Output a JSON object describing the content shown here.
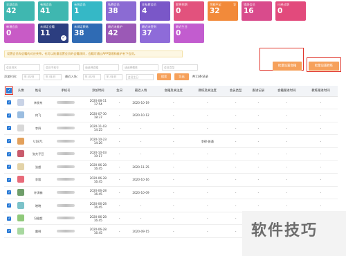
{
  "cards_row1": [
    {
      "label": "全部会员",
      "value": "42",
      "color": "#3fb7b0"
    },
    {
      "label": "有效会员",
      "value": "41",
      "color": "#3fb7b0"
    },
    {
      "label": "无效会员",
      "value": "1",
      "color": "#35b8c6"
    },
    {
      "label": "私教会员",
      "value": "38",
      "color": "#8b6bd3"
    },
    {
      "label": "非私教会员",
      "value": "4",
      "color": "#7a57c8"
    },
    {
      "label": "即将到期",
      "value": "0",
      "color": "#e2527d"
    },
    {
      "label": "余额不足",
      "value": "32",
      "color": "#f28a3a",
      "tag": "导"
    },
    {
      "label": "锁屏会员",
      "value": "16",
      "color": "#d94b8c"
    },
    {
      "label": "已经过期",
      "value": "0",
      "color": "#e24a7c"
    }
  ],
  "cards_row2": [
    {
      "label": "新增会员",
      "value": "0",
      "color": "#c85bc6"
    },
    {
      "label": "未绑定会籍",
      "value": "11",
      "color": "#2c3e80",
      "checked": true
    },
    {
      "label": "未绑定教练",
      "value": "38",
      "color": "#2f6bb4"
    },
    {
      "label": "最近未维护",
      "value": "42",
      "color": "#9b59b6"
    },
    {
      "label": "最近未签到",
      "value": "37",
      "color": "#8e6bd9"
    },
    {
      "label": "最近生日",
      "value": "0",
      "color": "#c25ccf"
    }
  ],
  "notice": "设置会员和会籍的对应关系，也可以批量设置会员的会籍顾问，会籍可通过APP管理和维护名下会员。",
  "actions": {
    "assign_consultant": "批量设置会籍",
    "assign_coach": "批量设置教练"
  },
  "filters": {
    "row1": [
      "会员姓名",
      "会员手机号",
      "请选择会籍",
      "请选择教练",
      "会员类型"
    ],
    "added_time_label": "添加时间：",
    "date_placeholder": "年 /月/日",
    "last_visit_label": "最近入场：",
    "birthday_placeholder": "会员生日",
    "search_label": "搜索",
    "reset_label": "导出",
    "count_text": "共11条记录"
  },
  "table": {
    "headers": [
      "",
      "头像",
      "姓名",
      "手机号",
      "添加时间",
      "生日",
      "最近入场",
      "会籍及关注度",
      "教练及关注度",
      "会员类型",
      "跟进记录",
      "会籍跟进时间",
      "教练跟进时间"
    ],
    "rows": [
      {
        "avatar_color": "#c9d3e6",
        "name": "李俊东",
        "added": "2020-08-11\n17:54",
        "birthday": "-",
        "last": "2020-10-19",
        "consultant": "-",
        "coach": "-",
        "type": "-",
        "follow": "-",
        "ct": "-",
        "cht": "-"
      },
      {
        "avatar_color": "#9bbde0",
        "name": "何飞",
        "added": "2020-07-30\n18:37",
        "birthday": "-",
        "last": "2020-10-12",
        "consultant": "-",
        "coach": "-",
        "type": "-",
        "follow": "-",
        "ct": "-",
        "cht": "-"
      },
      {
        "avatar_color": "#d8d8d8",
        "name": "李四",
        "added": "2020-11-03\n14:25",
        "birthday": "-",
        "last": "-",
        "consultant": "-",
        "coach": "-",
        "type": "-",
        "follow": "-",
        "ct": "-",
        "cht": "-"
      },
      {
        "avatar_color": "#e3a15c",
        "name": "U1871",
        "added": "2020-10-23\n14:26",
        "birthday": "-",
        "last": "-",
        "consultant": "-",
        "coach": "李律·普通",
        "type": "-",
        "follow": "-",
        "ct": "-",
        "cht": "-"
      },
      {
        "avatar_color": "#c95b6c",
        "name": "张大子豆",
        "added": "2020-10-03\n19:17",
        "birthday": "-",
        "last": "-",
        "consultant": "-",
        "coach": "-",
        "type": "-",
        "follow": "-",
        "ct": "-",
        "cht": "-"
      },
      {
        "avatar_color": "#e3d3a8",
        "name": "张超",
        "added": "2020-06-28\n16:45",
        "birthday": "-",
        "last": "2020-11-25",
        "consultant": "-",
        "coach": "-",
        "type": "-",
        "follow": "-",
        "ct": "-",
        "cht": "-"
      },
      {
        "avatar_color": "#e86a79",
        "name": "李毅",
        "added": "2020-06-28\n16:45",
        "birthday": "-",
        "last": "2020-10-16",
        "consultant": "-",
        "coach": "-",
        "type": "-",
        "follow": "-",
        "ct": "-",
        "cht": "-"
      },
      {
        "avatar_color": "#6f9e6a",
        "name": "许琪楠",
        "added": "2020-06-28\n16:45",
        "birthday": "-",
        "last": "2020-10-09",
        "consultant": "-",
        "coach": "-",
        "type": "-",
        "follow": "-",
        "ct": "-",
        "cht": "-"
      },
      {
        "avatar_color": "#7bc2c9",
        "name": "晓晓",
        "added": "2020-06-28\n16:45",
        "birthday": "-",
        "last": "-",
        "consultant": "-",
        "coach": "-",
        "type": "-",
        "follow": "-",
        "ct": "-",
        "cht": "-"
      },
      {
        "avatar_color": "#8fc97a",
        "name": "冯翅超",
        "added": "2020-06-28\n16:45",
        "birthday": "-",
        "last": "-",
        "consultant": "-",
        "coach": "-",
        "type": "-",
        "follow": "-",
        "ct": "-",
        "cht": "-"
      },
      {
        "avatar_color": "#a8d8a0",
        "name": "雷明",
        "added": "2020-06-28\n16:45",
        "birthday": "-",
        "last": "2020-09-15",
        "consultant": "-",
        "coach": "-",
        "type": "-",
        "follow": "-",
        "ct": "-",
        "cht": "-"
      }
    ]
  },
  "watermark": "软件技巧"
}
